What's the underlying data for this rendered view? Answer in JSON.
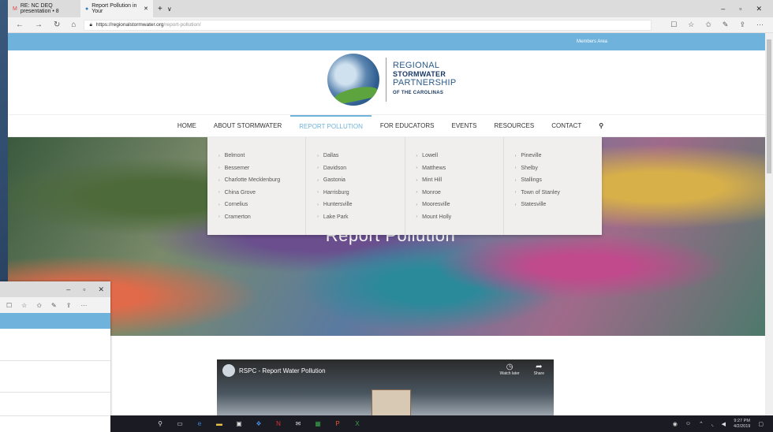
{
  "browser": {
    "tabs": [
      {
        "label": "RE: NC DEQ presentation • 8"
      },
      {
        "label": "Report Pollution in Your"
      }
    ],
    "new_tab": "+",
    "tab_menu": "∨",
    "window_controls": [
      "–",
      "▫",
      "✕"
    ],
    "url_host": "https://regionalstormwater.org",
    "url_path": "/report-pollution/",
    "nav_icons": [
      "←",
      "→",
      "↻",
      "⌂"
    ],
    "right_icons": [
      "☐",
      "☆",
      "✩",
      "✎",
      "⇪",
      "···"
    ]
  },
  "site": {
    "topbar_link": "Members Area",
    "logo": {
      "line1": "REGIONAL",
      "line2": "STORMWATER",
      "line3": "PARTNERSHIP",
      "line4": "OF THE CAROLINAS"
    },
    "menu": [
      "HOME",
      "ABOUT STORMWATER",
      "REPORT POLLUTION",
      "FOR EDUCATORS",
      "EVENTS",
      "RESOURCES",
      "CONTACT"
    ],
    "search_icon": "🔍",
    "hero_title": "Report Pollution",
    "dropdown": [
      [
        "Belmont",
        "Bessemer",
        "Charlotte Mecklenburg",
        "China Grove",
        "Cornelius",
        "Cramerton"
      ],
      [
        "Dallas",
        "Davidson",
        "Gastonia",
        "Harrisburg",
        "Huntersville",
        "Lake Park"
      ],
      [
        "Lowell",
        "Matthews",
        "Mint Hill",
        "Monroe",
        "Mooresville",
        "Mount Holly"
      ],
      [
        "Pineville",
        "Shelby",
        "Stallings",
        "Town of Stanley",
        "Statesville"
      ]
    ],
    "video": {
      "title": "RSPC - Report Water Pollution",
      "watch_later": "Watch later",
      "share": "Share"
    }
  },
  "second_window": {
    "controls": [
      "–",
      "▫",
      "✕"
    ],
    "icons": [
      "☐",
      "☆",
      "✩",
      "✎",
      "⇪",
      "···"
    ]
  },
  "taskbar": {
    "time": "9:27 PM",
    "date": "4/2/2019"
  },
  "colors": {
    "accent": "#6fb3dc",
    "dropdown_bg": "#f1efed"
  }
}
